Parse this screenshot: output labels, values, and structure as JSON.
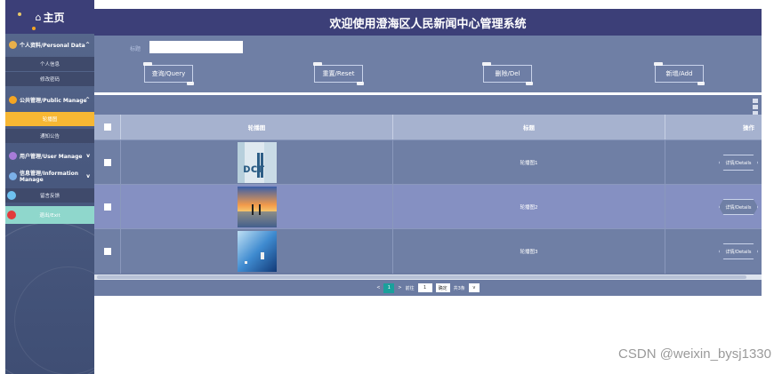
{
  "sidebar": {
    "home_label": "主页",
    "groups": [
      {
        "label": "个人资料/Personal Data",
        "items": [
          "个人信息",
          "修改密码"
        ]
      },
      {
        "label": "公共管理/Public Manage",
        "items": [
          "轮播图",
          "通知公告"
        ]
      },
      {
        "label": "用户管理/User Manage"
      },
      {
        "label": "信息管理/Information Manage",
        "items": [
          "留言反馈"
        ]
      }
    ],
    "exit_label": "退出/Exit"
  },
  "header": {
    "title": "欢迎使用澄海区人民新闻中心管理系统"
  },
  "search": {
    "label": "标题",
    "value": ""
  },
  "buttons": {
    "query": "查询/Query",
    "reset": "重置/Reset",
    "delete": "删除/Del",
    "add": "新增/Add"
  },
  "table": {
    "columns": [
      "轮播图",
      "标题",
      "操作"
    ],
    "rows": [
      {
        "title": "轮播图1",
        "action": "详情/Details"
      },
      {
        "title": "轮播图2",
        "action": "详情/Details"
      },
      {
        "title": "轮播图3",
        "action": "详情/Details"
      }
    ]
  },
  "pagination": {
    "current_page": "1",
    "goto_label": "前往",
    "goto_value": "1",
    "confirm": "确定",
    "total": "共3条",
    "page_size": "10"
  },
  "watermark": "CSDN @weixin_bysj1330",
  "colors": {
    "header": "#3c3f78",
    "active_yellow": "#f7b733",
    "active_teal": "#8fd7cc",
    "page_current": "#1aa09b"
  }
}
